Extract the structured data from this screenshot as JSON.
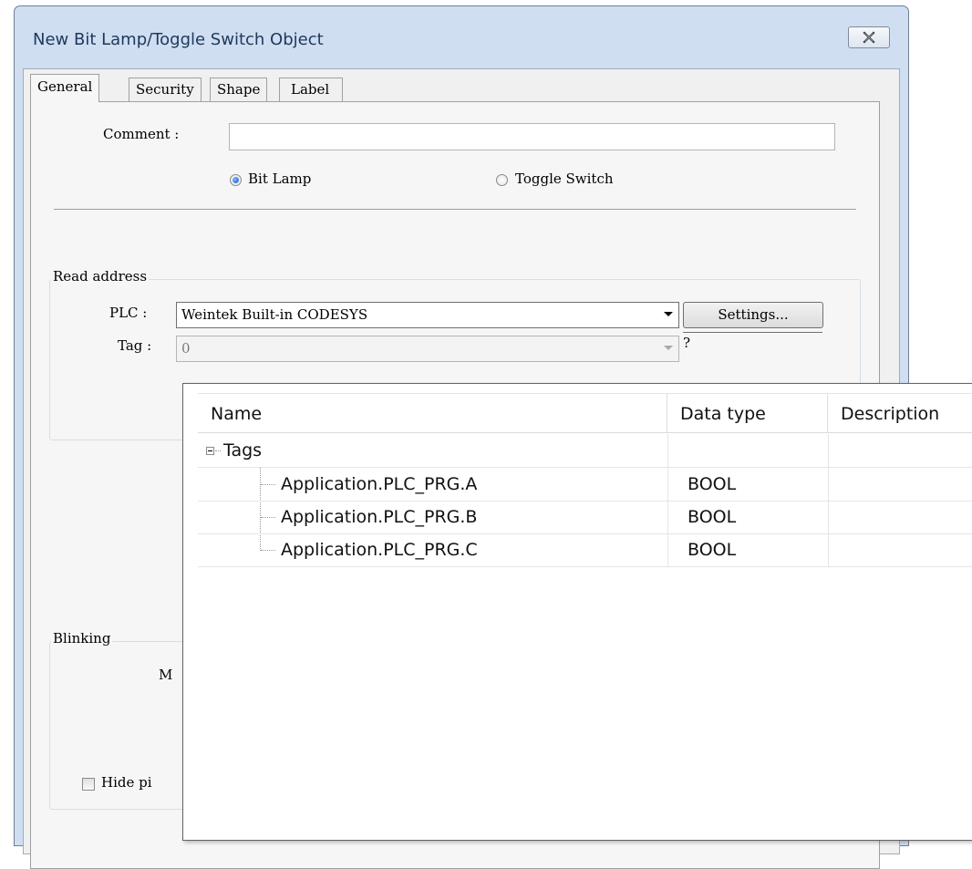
{
  "window": {
    "title": "New Bit Lamp/Toggle Switch Object",
    "close_icon": "close-icon"
  },
  "tabs": [
    {
      "label": "General",
      "active": true
    },
    {
      "label": "Security",
      "active": false
    },
    {
      "label": "Shape",
      "active": false
    },
    {
      "label": "Label",
      "active": false
    }
  ],
  "general": {
    "comment_label": "Comment :",
    "comment_value": "",
    "mode_options": [
      {
        "label": "Bit Lamp",
        "selected": true
      },
      {
        "label": "Toggle Switch",
        "selected": false
      }
    ]
  },
  "read_address": {
    "group_label": "Read address",
    "plc_label": "PLC :",
    "plc_value": "Weintek Built-in CODESYS",
    "settings_label": "Settings...",
    "tag_label": "Tag :",
    "tag_value": "0",
    "tag_help": "?"
  },
  "blinking": {
    "group_label": "Blinking",
    "mode_label_partial": "M",
    "hide_label_partial": "Hide pi",
    "hide_checked": false
  },
  "tag_list": {
    "columns": [
      "Name",
      "Data type",
      "Description"
    ],
    "root": {
      "label": "Tags",
      "expanded": true
    },
    "rows": [
      {
        "name": "Application.PLC_PRG.A",
        "type": "BOOL",
        "description": ""
      },
      {
        "name": "Application.PLC_PRG.B",
        "type": "BOOL",
        "description": ""
      },
      {
        "name": "Application.PLC_PRG.C",
        "type": "BOOL",
        "description": ""
      }
    ]
  }
}
